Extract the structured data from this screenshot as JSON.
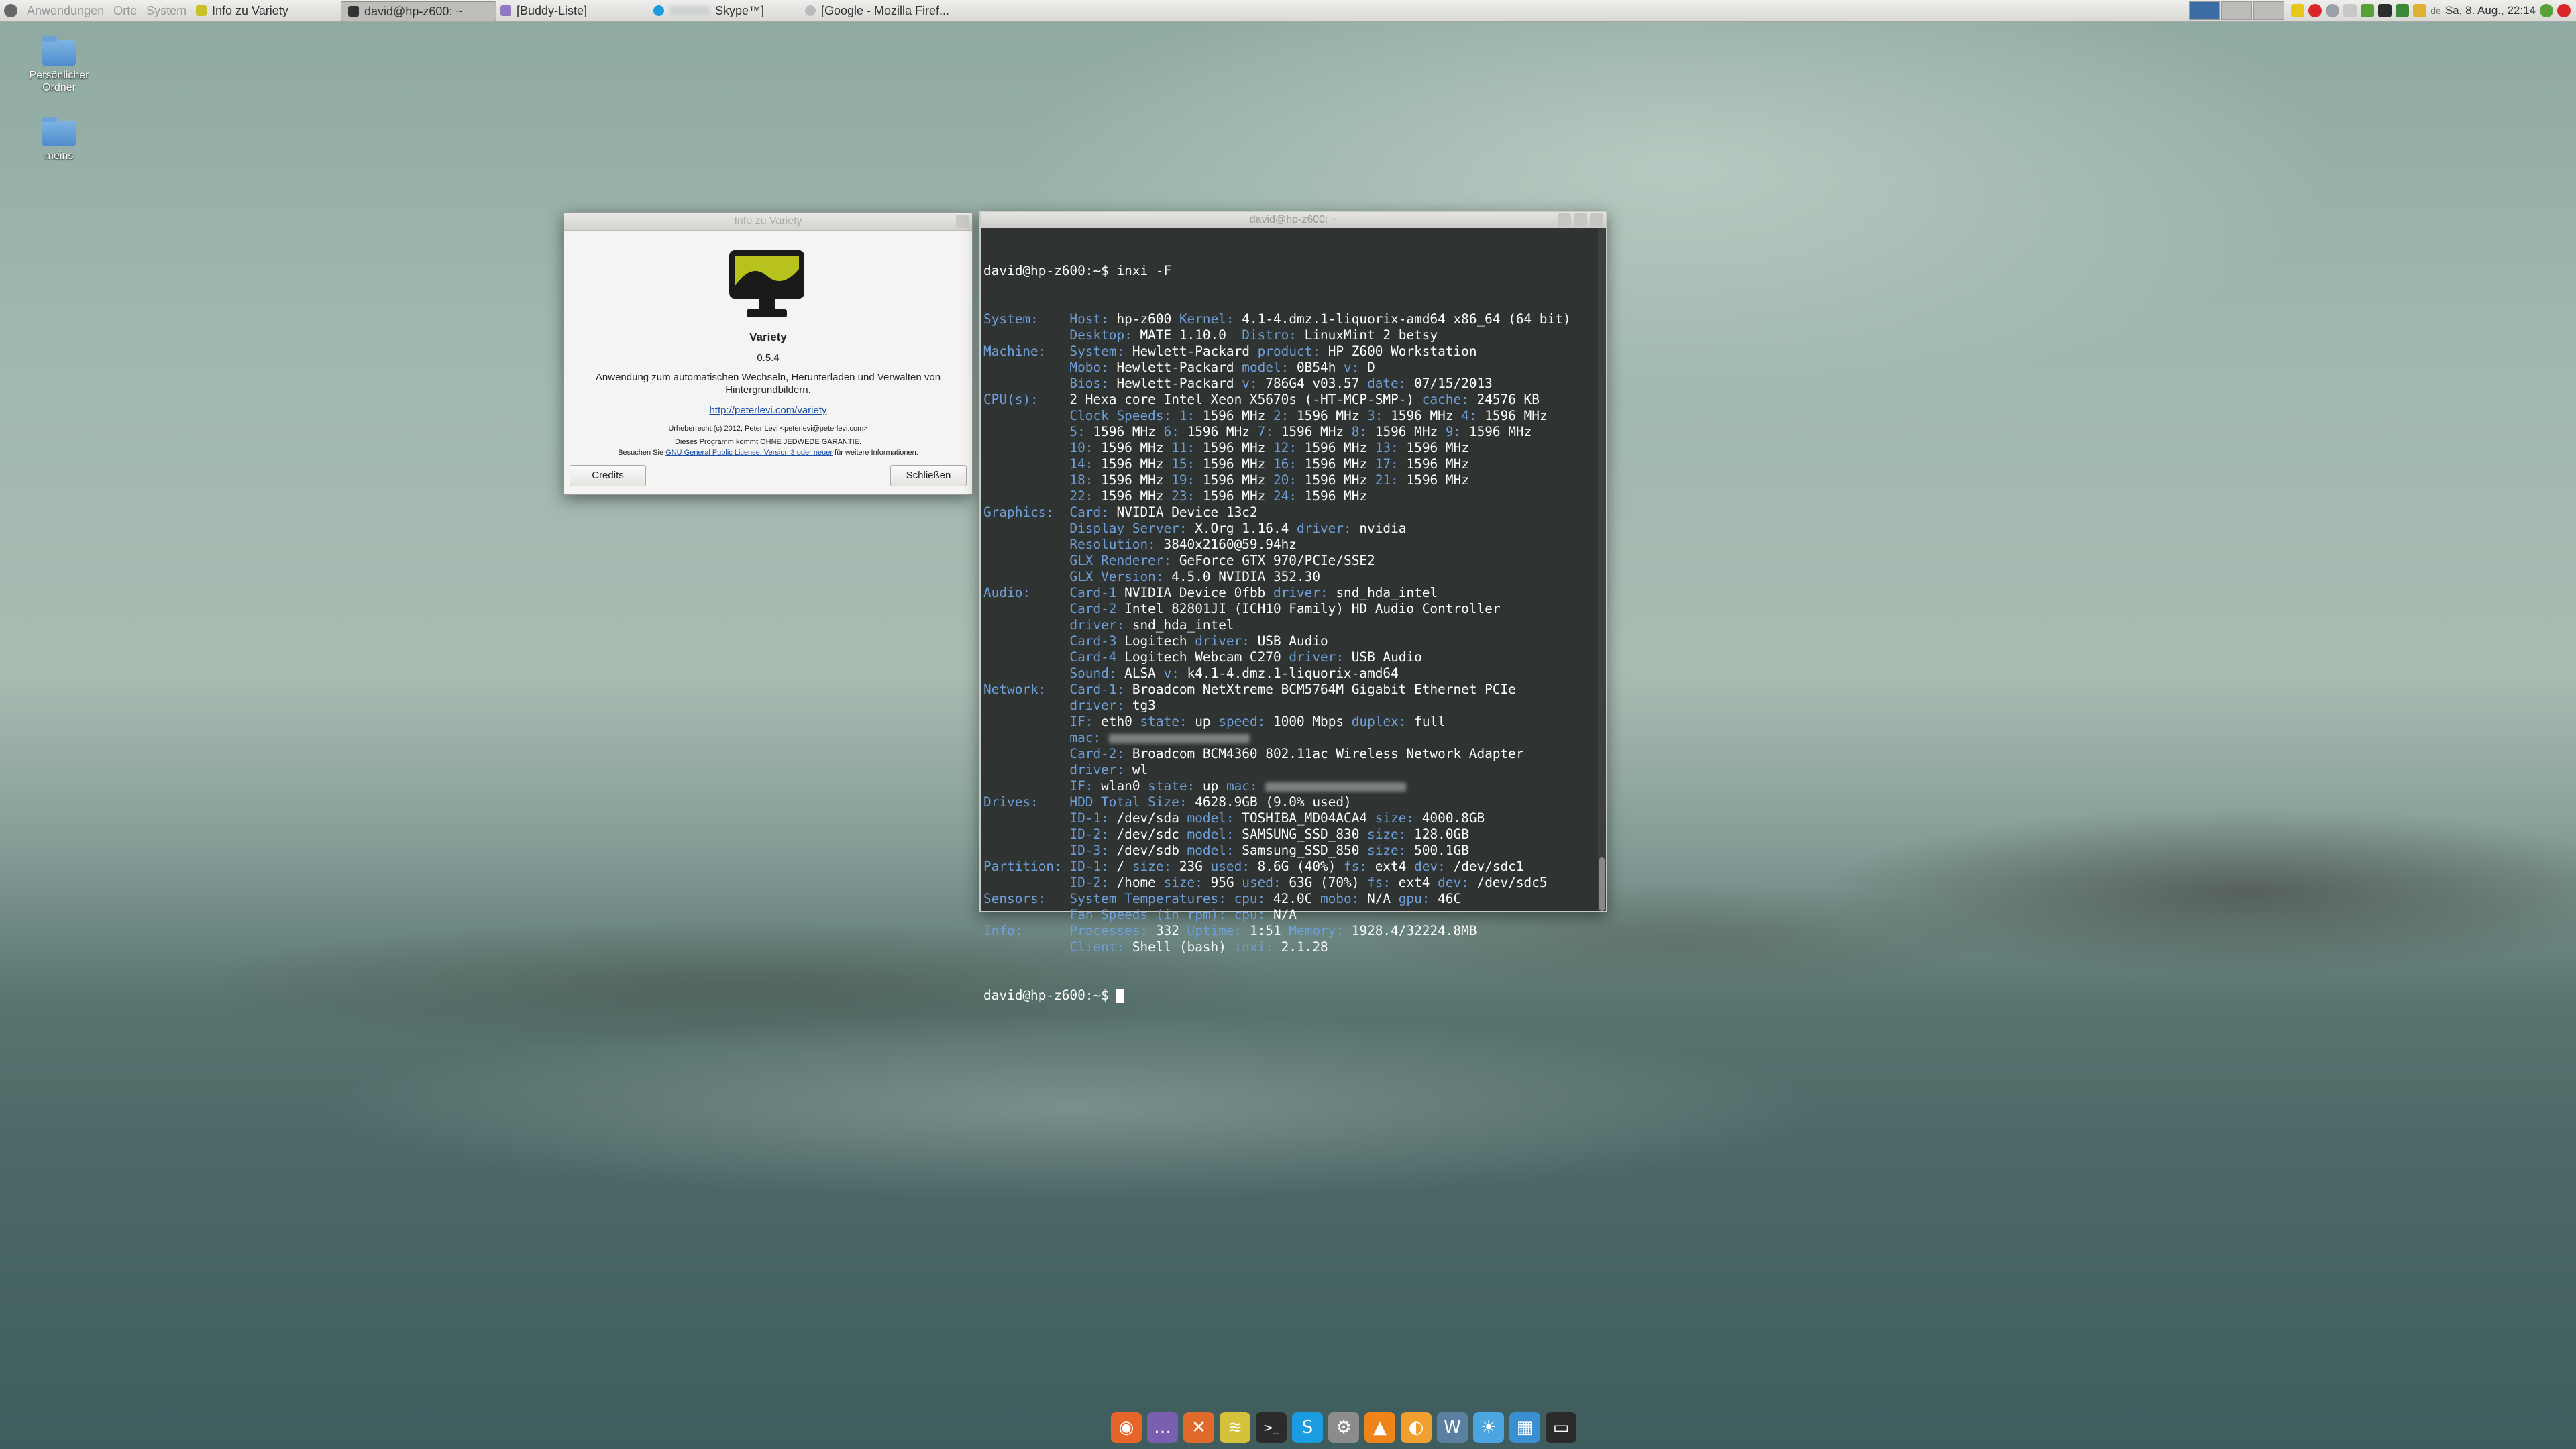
{
  "top_panel": {
    "menus": [
      "Anwendungen",
      "Orte",
      "System"
    ],
    "tasks": [
      {
        "label": "Info zu Variety",
        "active": false
      },
      {
        "label": "david@hp-z600: ~",
        "active": true
      },
      {
        "label": "[Buddy-Liste]",
        "active": false
      },
      {
        "label": "Skype™]",
        "active": false
      },
      {
        "label": "[Google - Mozilla Firef...",
        "active": false
      }
    ],
    "lang": "de",
    "clock": "Sa, 8. Aug., 22:14"
  },
  "desktop_icons": [
    {
      "label": "Persönlicher Ordner"
    },
    {
      "label": "meins"
    }
  ],
  "about_dialog": {
    "title": "Info zu Variety",
    "app_name": "Variety",
    "version": "0.5.4",
    "description": "Anwendung zum automatischen Wechseln, Herunterladen und Verwalten von Hintergrundbildern.",
    "website": "http://peterlevi.com/variety",
    "copyright": "Urheberrecht (c) 2012, Peter Levi <peterlevi@peterlevi.com>",
    "warranty": "Dieses Programm kommt OHNE JEDWEDE GARANTIE.",
    "license_prefix": "Besuchen Sie ",
    "license_link": "GNU General Public License, Version 3 oder neuer",
    "license_suffix": " für weitere Informationen.",
    "credits_label": "Credits",
    "close_label": "Schließen"
  },
  "terminal": {
    "title": "david@hp-z600: ~",
    "prompt": "david@hp-z600:~$ ",
    "command": "inxi -F",
    "lines": [
      [
        [
          "k",
          "System:    "
        ],
        [
          "k",
          "Host: "
        ],
        [
          "v",
          "hp-z600 "
        ],
        [
          "k",
          "Kernel: "
        ],
        [
          "v",
          "4.1-4.dmz.1-liquorix-amd64 x86_64 (64 bit)"
        ]
      ],
      [
        [
          "k",
          "           Desktop: "
        ],
        [
          "v",
          "MATE 1.10.0  "
        ],
        [
          "k",
          "Distro: "
        ],
        [
          "v",
          "LinuxMint 2 betsy"
        ]
      ],
      [
        [
          "k",
          "Machine:   "
        ],
        [
          "k",
          "System: "
        ],
        [
          "v",
          "Hewlett-Packard "
        ],
        [
          "k",
          "product: "
        ],
        [
          "v",
          "HP Z600 Workstation"
        ]
      ],
      [
        [
          "k",
          "           Mobo: "
        ],
        [
          "v",
          "Hewlett-Packard "
        ],
        [
          "k",
          "model: "
        ],
        [
          "v",
          "0B54h "
        ],
        [
          "k",
          "v: "
        ],
        [
          "v",
          "D"
        ]
      ],
      [
        [
          "k",
          "           Bios: "
        ],
        [
          "v",
          "Hewlett-Packard "
        ],
        [
          "k",
          "v: "
        ],
        [
          "v",
          "786G4 v03.57 "
        ],
        [
          "k",
          "date: "
        ],
        [
          "v",
          "07/15/2013"
        ]
      ],
      [
        [
          "k",
          "CPU(s):    "
        ],
        [
          "v",
          "2 Hexa core "
        ],
        [
          "v",
          "Intel Xeon X5670s (-HT-MCP-SMP-) "
        ],
        [
          "k",
          "cache: "
        ],
        [
          "v",
          "24576 KB"
        ]
      ],
      [
        [
          "k",
          "           Clock Speeds: 1: "
        ],
        [
          "v",
          "1596 MHz "
        ],
        [
          "k",
          "2: "
        ],
        [
          "v",
          "1596 MHz "
        ],
        [
          "k",
          "3: "
        ],
        [
          "v",
          "1596 MHz "
        ],
        [
          "k",
          "4: "
        ],
        [
          "v",
          "1596 MHz"
        ]
      ],
      [
        [
          "k",
          "           5: "
        ],
        [
          "v",
          "1596 MHz "
        ],
        [
          "k",
          "6: "
        ],
        [
          "v",
          "1596 MHz "
        ],
        [
          "k",
          "7: "
        ],
        [
          "v",
          "1596 MHz "
        ],
        [
          "k",
          "8: "
        ],
        [
          "v",
          "1596 MHz "
        ],
        [
          "k",
          "9: "
        ],
        [
          "v",
          "1596 MHz"
        ]
      ],
      [
        [
          "k",
          "           10: "
        ],
        [
          "v",
          "1596 MHz "
        ],
        [
          "k",
          "11: "
        ],
        [
          "v",
          "1596 MHz "
        ],
        [
          "k",
          "12: "
        ],
        [
          "v",
          "1596 MHz "
        ],
        [
          "k",
          "13: "
        ],
        [
          "v",
          "1596 MHz"
        ]
      ],
      [
        [
          "k",
          "           14: "
        ],
        [
          "v",
          "1596 MHz "
        ],
        [
          "k",
          "15: "
        ],
        [
          "v",
          "1596 MHz "
        ],
        [
          "k",
          "16: "
        ],
        [
          "v",
          "1596 MHz "
        ],
        [
          "k",
          "17: "
        ],
        [
          "v",
          "1596 MHz"
        ]
      ],
      [
        [
          "k",
          "           18: "
        ],
        [
          "v",
          "1596 MHz "
        ],
        [
          "k",
          "19: "
        ],
        [
          "v",
          "1596 MHz "
        ],
        [
          "k",
          "20: "
        ],
        [
          "v",
          "1596 MHz "
        ],
        [
          "k",
          "21: "
        ],
        [
          "v",
          "1596 MHz"
        ]
      ],
      [
        [
          "k",
          "           22: "
        ],
        [
          "v",
          "1596 MHz "
        ],
        [
          "k",
          "23: "
        ],
        [
          "v",
          "1596 MHz "
        ],
        [
          "k",
          "24: "
        ],
        [
          "v",
          "1596 MHz"
        ]
      ],
      [
        [
          "k",
          "Graphics:  "
        ],
        [
          "k",
          "Card: "
        ],
        [
          "v",
          "NVIDIA Device 13c2"
        ]
      ],
      [
        [
          "k",
          "           Display Server: "
        ],
        [
          "v",
          "X.Org 1.16.4 "
        ],
        [
          "k",
          "driver: "
        ],
        [
          "v",
          "nvidia"
        ]
      ],
      [
        [
          "k",
          "           Resolution: "
        ],
        [
          "v",
          "3840x2160@59.94hz"
        ]
      ],
      [
        [
          "k",
          "           GLX Renderer: "
        ],
        [
          "v",
          "GeForce GTX 970/PCIe/SSE2"
        ]
      ],
      [
        [
          "k",
          "           GLX Version: "
        ],
        [
          "v",
          "4.5.0 NVIDIA 352.30"
        ]
      ],
      [
        [
          "k",
          "Audio:     "
        ],
        [
          "k",
          "Card-1 "
        ],
        [
          "v",
          "NVIDIA Device 0fbb "
        ],
        [
          "k",
          "driver: "
        ],
        [
          "v",
          "snd_hda_intel"
        ]
      ],
      [
        [
          "k",
          "           Card-2 "
        ],
        [
          "v",
          "Intel 82801JI (ICH10 Family) HD Audio Controller"
        ]
      ],
      [
        [
          "k",
          "           driver: "
        ],
        [
          "v",
          "snd_hda_intel"
        ]
      ],
      [
        [
          "k",
          "           Card-3 "
        ],
        [
          "v",
          "Logitech "
        ],
        [
          "k",
          "driver: "
        ],
        [
          "v",
          "USB Audio"
        ]
      ],
      [
        [
          "k",
          "           Card-4 "
        ],
        [
          "v",
          "Logitech Webcam C270 "
        ],
        [
          "k",
          "driver: "
        ],
        [
          "v",
          "USB Audio"
        ]
      ],
      [
        [
          "k",
          "           Sound: "
        ],
        [
          "v",
          "ALSA "
        ],
        [
          "k",
          "v: "
        ],
        [
          "v",
          "k4.1-4.dmz.1-liquorix-amd64"
        ]
      ],
      [
        [
          "k",
          "Network:   "
        ],
        [
          "k",
          "Card-1: "
        ],
        [
          "v",
          "Broadcom NetXtreme BCM5764M Gigabit Ethernet PCIe"
        ]
      ],
      [
        [
          "k",
          "           driver: "
        ],
        [
          "v",
          "tg3"
        ]
      ],
      [
        [
          "k",
          "           IF: "
        ],
        [
          "v",
          "eth0 "
        ],
        [
          "k",
          "state: "
        ],
        [
          "v",
          "up "
        ],
        [
          "k",
          "speed: "
        ],
        [
          "v",
          "1000 Mbps "
        ],
        [
          "k",
          "duplex: "
        ],
        [
          "v",
          "full"
        ]
      ],
      [
        [
          "k",
          "           mac: "
        ],
        [
          "b",
          ""
        ]
      ],
      [
        [
          "k",
          "           Card-2: "
        ],
        [
          "v",
          "Broadcom BCM4360 802.11ac Wireless Network Adapter"
        ]
      ],
      [
        [
          "k",
          "           driver: "
        ],
        [
          "v",
          "wl"
        ]
      ],
      [
        [
          "k",
          "           IF: "
        ],
        [
          "v",
          "wlan0 "
        ],
        [
          "k",
          "state: "
        ],
        [
          "v",
          "up "
        ],
        [
          "k",
          "mac: "
        ],
        [
          "b",
          ""
        ]
      ],
      [
        [
          "k",
          "Drives:    "
        ],
        [
          "k",
          "HDD Total Size: "
        ],
        [
          "v",
          "4628.9GB (9.0% used)"
        ]
      ],
      [
        [
          "k",
          "           ID-1: "
        ],
        [
          "v",
          "/dev/sda "
        ],
        [
          "k",
          "model: "
        ],
        [
          "v",
          "TOSHIBA_MD04ACA4 "
        ],
        [
          "k",
          "size: "
        ],
        [
          "v",
          "4000.8GB"
        ]
      ],
      [
        [
          "k",
          "           ID-2: "
        ],
        [
          "v",
          "/dev/sdc "
        ],
        [
          "k",
          "model: "
        ],
        [
          "v",
          "SAMSUNG_SSD_830 "
        ],
        [
          "k",
          "size: "
        ],
        [
          "v",
          "128.0GB"
        ]
      ],
      [
        [
          "k",
          "           ID-3: "
        ],
        [
          "v",
          "/dev/sdb "
        ],
        [
          "k",
          "model: "
        ],
        [
          "v",
          "Samsung_SSD_850 "
        ],
        [
          "k",
          "size: "
        ],
        [
          "v",
          "500.1GB"
        ]
      ],
      [
        [
          "k",
          "Partition: "
        ],
        [
          "k",
          "ID-1: "
        ],
        [
          "v",
          "/ "
        ],
        [
          "k",
          "size: "
        ],
        [
          "v",
          "23G "
        ],
        [
          "k",
          "used: "
        ],
        [
          "v",
          "8.6G (40%) "
        ],
        [
          "k",
          "fs: "
        ],
        [
          "v",
          "ext4 "
        ],
        [
          "k",
          "dev: "
        ],
        [
          "v",
          "/dev/sdc1"
        ]
      ],
      [
        [
          "k",
          "           ID-2: "
        ],
        [
          "v",
          "/home "
        ],
        [
          "k",
          "size: "
        ],
        [
          "v",
          "95G "
        ],
        [
          "k",
          "used: "
        ],
        [
          "v",
          "63G (70%) "
        ],
        [
          "k",
          "fs: "
        ],
        [
          "v",
          "ext4 "
        ],
        [
          "k",
          "dev: "
        ],
        [
          "v",
          "/dev/sdc5"
        ]
      ],
      [
        [
          "k",
          "Sensors:   "
        ],
        [
          "k",
          "System Temperatures: cpu: "
        ],
        [
          "v",
          "42.0C "
        ],
        [
          "k",
          "mobo: "
        ],
        [
          "v",
          "N/A "
        ],
        [
          "k",
          "gpu: "
        ],
        [
          "v",
          "46C"
        ]
      ],
      [
        [
          "k",
          "           Fan Speeds (in rpm): cpu: "
        ],
        [
          "v",
          "N/A"
        ]
      ],
      [
        [
          "k",
          "Info:      "
        ],
        [
          "k",
          "Processes: "
        ],
        [
          "v",
          "332 "
        ],
        [
          "k",
          "Uptime: "
        ],
        [
          "v",
          "1:51 "
        ],
        [
          "k",
          "Memory: "
        ],
        [
          "v",
          "1928.4/32224.8MB"
        ]
      ],
      [
        [
          "k",
          "           Client: "
        ],
        [
          "v",
          "Shell (bash) "
        ],
        [
          "k",
          "inxi: "
        ],
        [
          "v",
          "2.1.28"
        ]
      ]
    ]
  },
  "dock": {
    "items": [
      {
        "icon": "firefox-icon",
        "glyph": "◉",
        "color": "#e8652a"
      },
      {
        "icon": "pidgin-icon",
        "glyph": "…",
        "color": "#7a5fb0"
      },
      {
        "icon": "tools-icon",
        "glyph": "✕",
        "color": "#e06a2a"
      },
      {
        "icon": "hexchat-icon",
        "glyph": "≋",
        "color": "#d5c13a"
      },
      {
        "icon": "terminal-icon",
        "glyph": ">_",
        "color": "#2b2b2b"
      },
      {
        "icon": "skype-icon",
        "glyph": "S",
        "color": "#1b9be0"
      },
      {
        "icon": "settings-icon",
        "glyph": "⚙",
        "color": "#8c8c8c"
      },
      {
        "icon": "vlc-icon",
        "glyph": "▲",
        "color": "#f08418"
      },
      {
        "icon": "fruit-icon",
        "glyph": "◐",
        "color": "#f0a030"
      },
      {
        "icon": "wordpress-icon",
        "glyph": "W",
        "color": "#5a7fa0"
      },
      {
        "icon": "weather-icon",
        "glyph": "☀",
        "color": "#4aa5e0"
      },
      {
        "icon": "monitor-icon",
        "glyph": "▦",
        "color": "#3a8fd0"
      },
      {
        "icon": "variety-icon",
        "glyph": "▭",
        "color": "#2a2a2a"
      }
    ]
  }
}
